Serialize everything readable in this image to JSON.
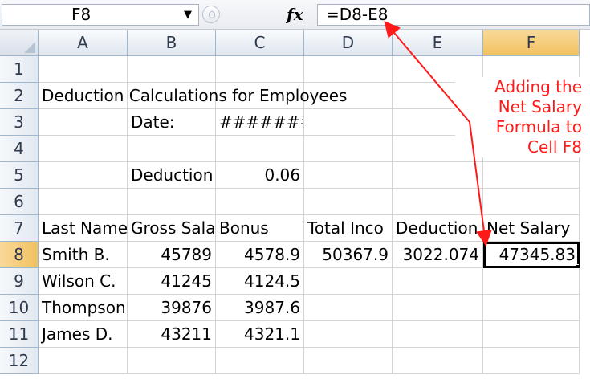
{
  "formula_bar": {
    "name_box": "F8",
    "name_box_dropdown_glyph": "▼",
    "fx_icon": "fx",
    "formula": "=D8-E8"
  },
  "columns": [
    "A",
    "B",
    "C",
    "D",
    "E",
    "F"
  ],
  "rows": [
    {
      "num": "1",
      "cells": [
        "",
        "",
        "",
        "",
        "",
        ""
      ]
    },
    {
      "num": "2",
      "cells": [
        "Deduction Calculations for Employees",
        "",
        "",
        "",
        "",
        ""
      ]
    },
    {
      "num": "3",
      "cells": [
        "",
        "Date:",
        "########",
        "",
        "",
        ""
      ]
    },
    {
      "num": "4",
      "cells": [
        "",
        "",
        "",
        "",
        "",
        ""
      ]
    },
    {
      "num": "5",
      "cells": [
        "",
        "Deduction",
        "0.06",
        "",
        "",
        ""
      ]
    },
    {
      "num": "6",
      "cells": [
        "",
        "",
        "",
        "",
        "",
        ""
      ]
    },
    {
      "num": "7",
      "cells": [
        "Last Name",
        "Gross Sala",
        "Bonus",
        "Total Inco",
        "Deduction",
        "Net Salary"
      ]
    },
    {
      "num": "8",
      "cells": [
        "Smith B.",
        "45789",
        "4578.9",
        "50367.9",
        "3022.074",
        "47345.83"
      ]
    },
    {
      "num": "9",
      "cells": [
        "Wilson C.",
        "41245",
        "4124.5",
        "",
        "",
        ""
      ]
    },
    {
      "num": "10",
      "cells": [
        "Thompson",
        "39876",
        "3987.6",
        "",
        "",
        ""
      ]
    },
    {
      "num": "11",
      "cells": [
        "James D.",
        "43211",
        "4321.1",
        "",
        "",
        ""
      ]
    },
    {
      "num": "12",
      "cells": [
        "",
        "",
        "",
        "",
        "",
        ""
      ]
    }
  ],
  "active_cell": "F8",
  "annotation": {
    "lines": [
      "Adding the",
      "Net Salary",
      "Formula to",
      "Cell F8"
    ],
    "color": "#ff1a1a"
  },
  "colors": {
    "header_bg": "#dfe6ef",
    "selected_header_bg": "#f1c15f",
    "gridline": "#d4d4d4",
    "annotation_red": "#ff1a1a"
  }
}
